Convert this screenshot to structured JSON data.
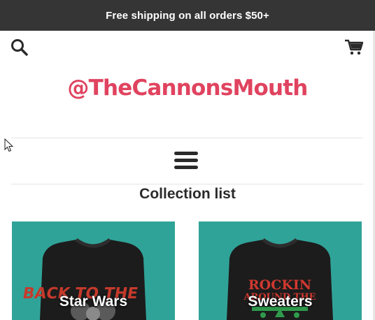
{
  "announcement": {
    "text": "Free shipping on all orders $50+"
  },
  "header": {
    "search_icon": "search-icon",
    "cart_icon": "cart-icon",
    "logo_text": "@TheCannonsMouth",
    "menu_icon": "hamburger-menu-icon"
  },
  "collections": {
    "title": "Collection list",
    "items": [
      {
        "label": "Star Wars",
        "shirt_art": "BACK TO THE"
      },
      {
        "label": "Sweaters",
        "shirt_art_line1": "ROCKIN",
        "shirt_art_line2": "AROUND THE"
      }
    ]
  },
  "colors": {
    "announcement_bg": "#353535",
    "logo": "#e0435f",
    "card_bg": "#30a398",
    "shirt": "#1c1c1c"
  }
}
